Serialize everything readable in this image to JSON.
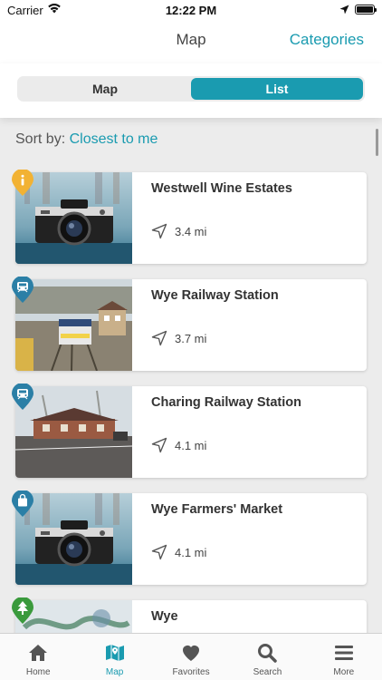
{
  "status": {
    "carrier": "Carrier",
    "time": "12:22 PM"
  },
  "nav": {
    "title": "Map",
    "categories": "Categories"
  },
  "segment": {
    "options": [
      "Map",
      "List"
    ],
    "selected": "List"
  },
  "sort": {
    "label": "Sort by:",
    "value": "Closest to me"
  },
  "items": [
    {
      "title": "Westwell Wine Estates",
      "distance": "3.4 mi",
      "pin_icon": "info-icon",
      "pin_color": "#f2b233",
      "image": "camera-photo"
    },
    {
      "title": "Wye Railway Station",
      "distance": "3.7 mi",
      "pin_icon": "train-icon",
      "pin_color": "#2b7fa6",
      "image": "railway-photo"
    },
    {
      "title": "Charing Railway Station",
      "distance": "4.1 mi",
      "pin_icon": "train-icon",
      "pin_color": "#2b7fa6",
      "image": "station-photo"
    },
    {
      "title": "Wye Farmers' Market",
      "distance": "4.1 mi",
      "pin_icon": "shopping-bag-icon",
      "pin_color": "#2b7fa6",
      "image": "camera-photo"
    },
    {
      "title": "Wye",
      "distance": "",
      "pin_icon": "tree-icon",
      "pin_color": "#3a9a3c",
      "image": "village-photo"
    }
  ],
  "tabs": [
    {
      "label": "Home",
      "icon": "home-icon"
    },
    {
      "label": "Map",
      "icon": "map-icon",
      "active": true
    },
    {
      "label": "Favorites",
      "icon": "heart-icon"
    },
    {
      "label": "Search",
      "icon": "search-icon"
    },
    {
      "label": "More",
      "icon": "menu-icon"
    }
  ],
  "colors": {
    "accent": "#1a9bb0",
    "background": "#ececec"
  }
}
